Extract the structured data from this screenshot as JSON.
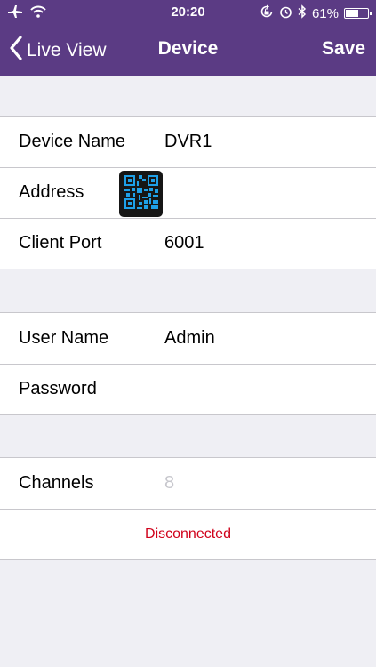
{
  "status_bar": {
    "time": "20:20",
    "battery_percent": 61,
    "battery_label": "61%",
    "icons": [
      "airplane-icon",
      "wifi-icon",
      "rotation-lock-icon",
      "alarm-icon",
      "bluetooth-icon",
      "battery-icon"
    ]
  },
  "nav": {
    "back_label": "Live View",
    "title": "Device",
    "save_label": "Save"
  },
  "colors": {
    "header": "#5b3b84",
    "disconnected": "#d0021b",
    "placeholder": "#c7c7cd",
    "qr_accent": "#1ea0e8"
  },
  "device": {
    "name_label": "Device Name",
    "name_value": "DVR1",
    "address_label": "Address",
    "address_value": "",
    "port_label": "Client Port",
    "port_value": "6001"
  },
  "credentials": {
    "user_label": "User Name",
    "user_value": "Admin",
    "password_label": "Password",
    "password_value": ""
  },
  "channels": {
    "label": "Channels",
    "placeholder": "8"
  },
  "connection_status": "Disconnected"
}
